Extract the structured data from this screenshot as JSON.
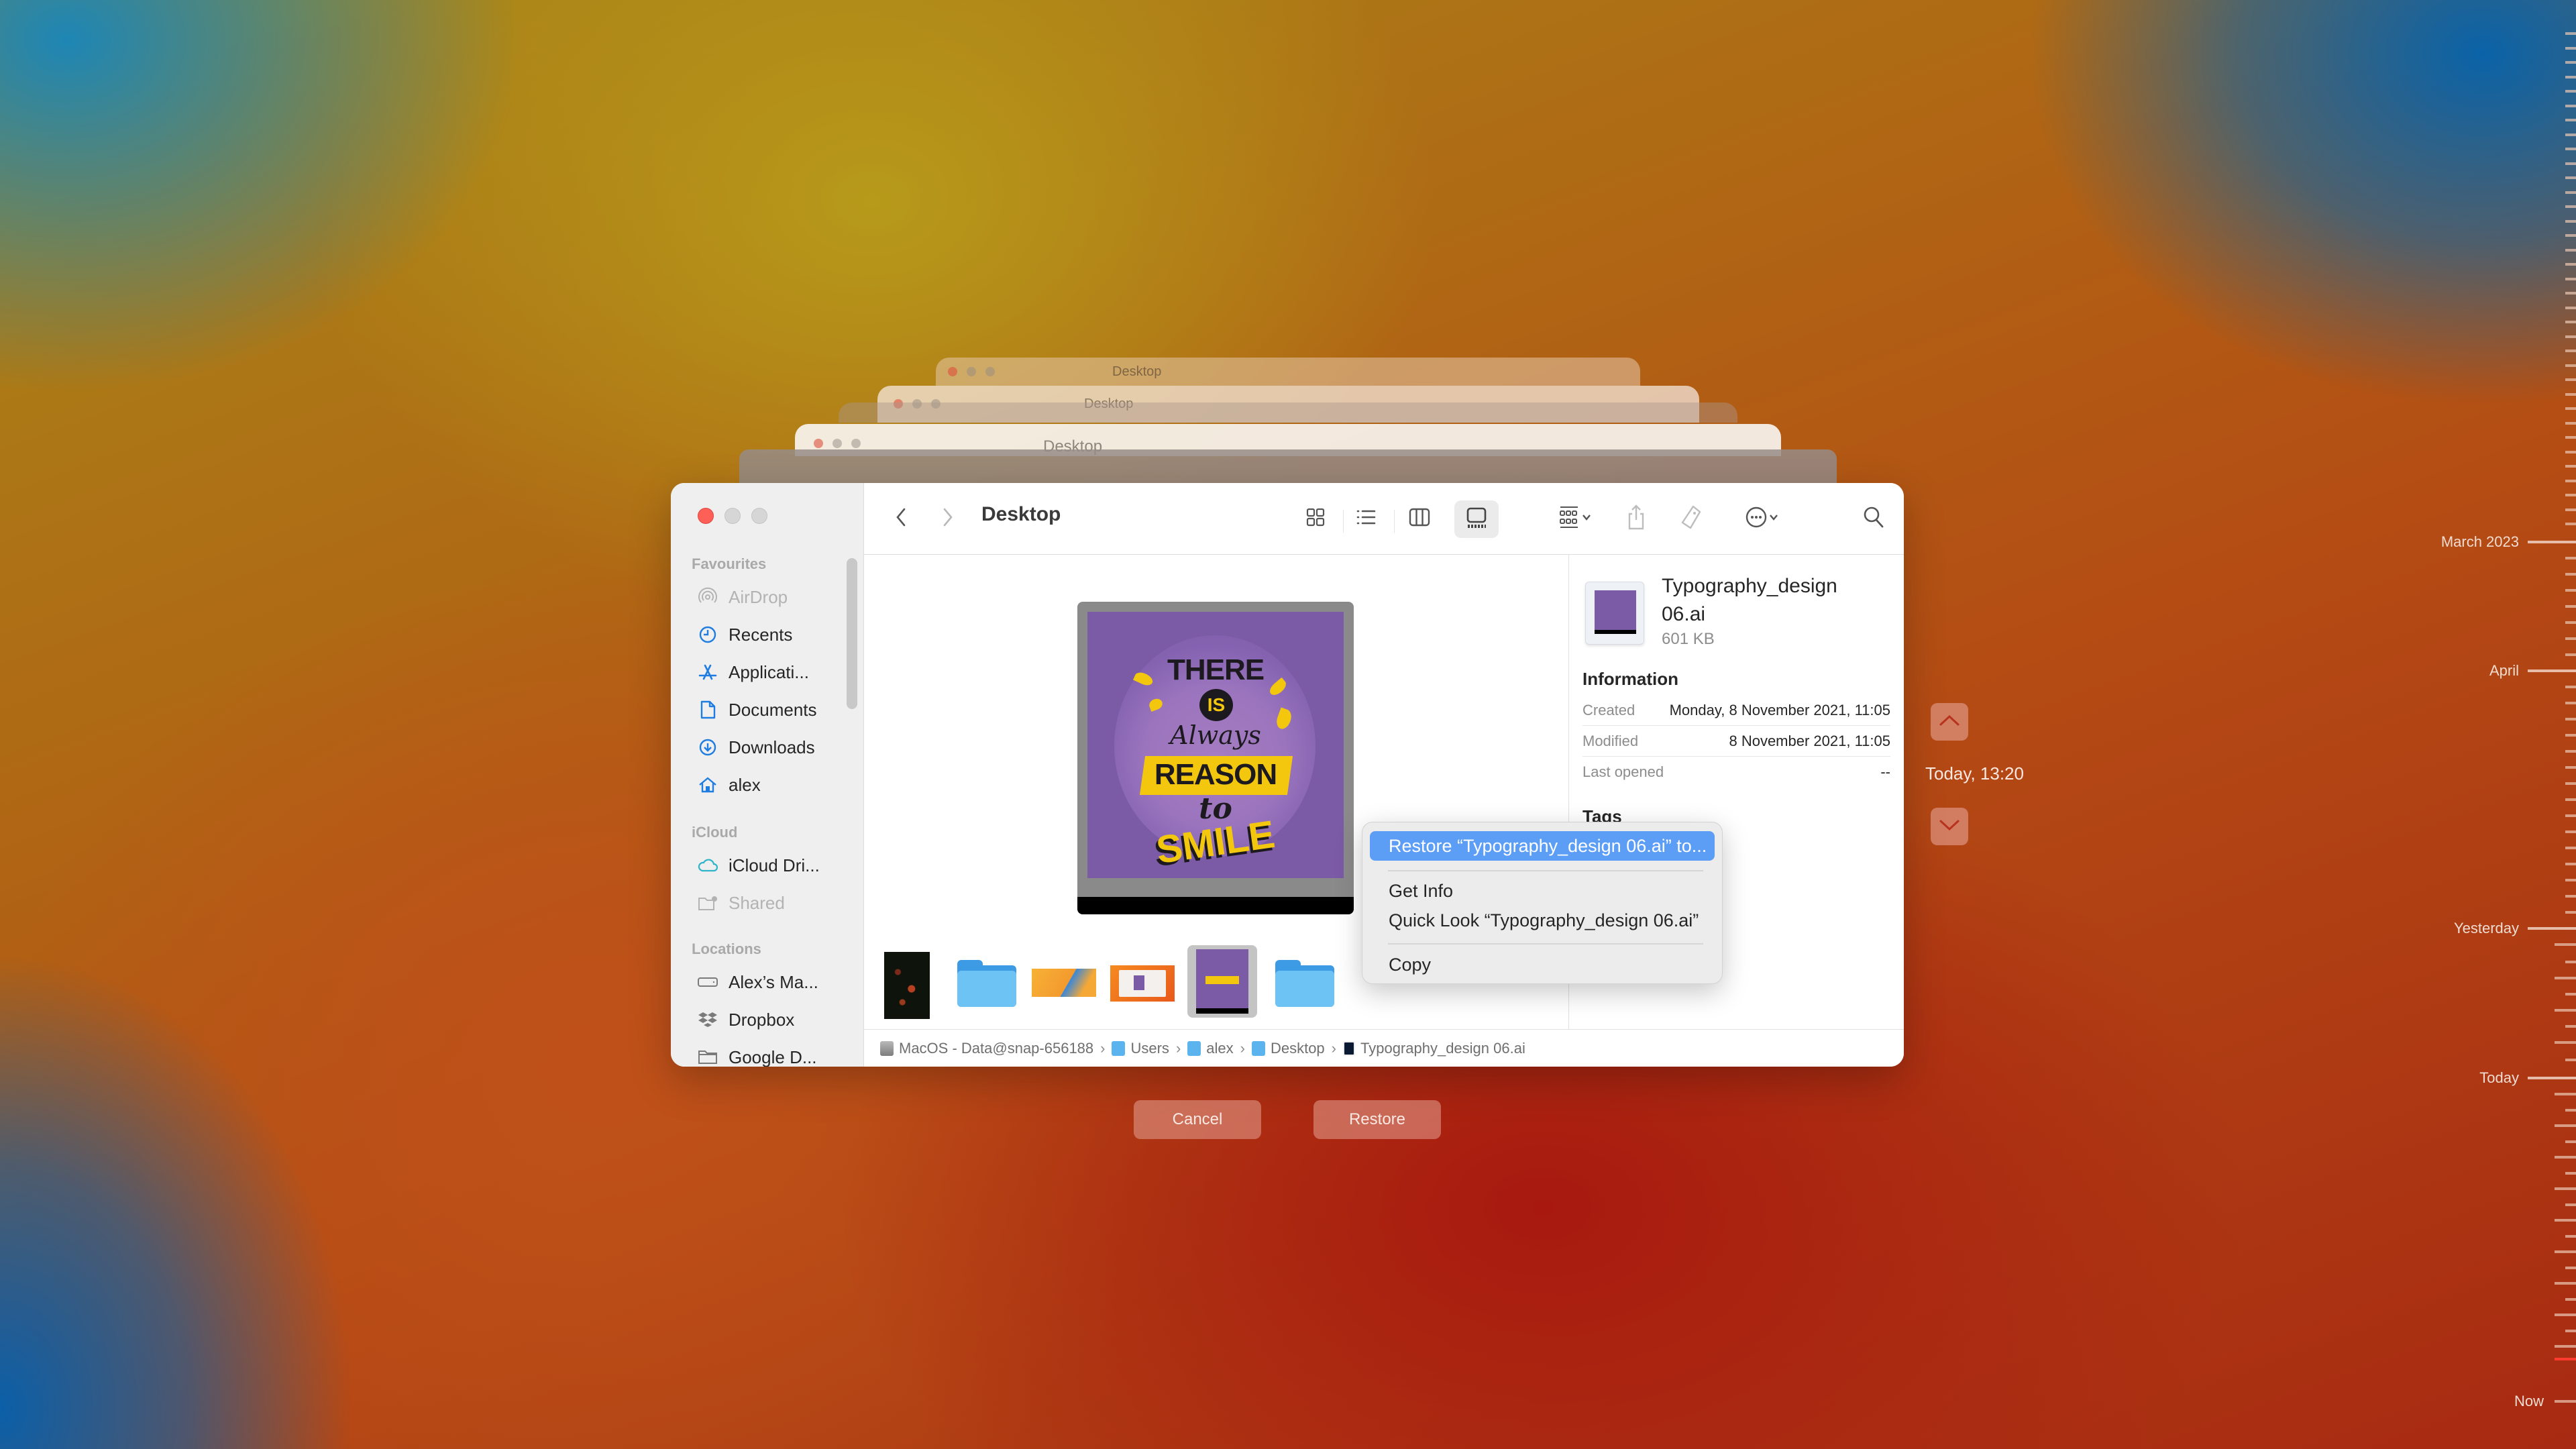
{
  "window": {
    "title": "Desktop",
    "background_windows": [
      {
        "title": "Desktop"
      },
      {
        "title": "Desktop"
      },
      {
        "title": "Desktop"
      }
    ]
  },
  "toolbar": {
    "back_icon": "chevron-left",
    "forward_icon": "chevron-right",
    "title": "Desktop",
    "views": [
      {
        "name": "icon-view",
        "active": false
      },
      {
        "name": "list-view",
        "active": false
      },
      {
        "name": "column-view",
        "active": false
      },
      {
        "name": "gallery-view",
        "active": true
      }
    ],
    "group_by_icon": "group-grid",
    "share_icon": "share",
    "tag_icon": "tag",
    "more_icon": "ellipsis-circle",
    "search_icon": "magnifying-glass"
  },
  "sidebar": {
    "sections": [
      {
        "title": "Favourites",
        "items": [
          {
            "label": "AirDrop",
            "icon": "airdrop",
            "dimmed": true
          },
          {
            "label": "Recents",
            "icon": "clock"
          },
          {
            "label": "Applicati...",
            "icon": "apps"
          },
          {
            "label": "Documents",
            "icon": "document"
          },
          {
            "label": "Downloads",
            "icon": "download"
          },
          {
            "label": "alex",
            "icon": "home"
          }
        ]
      },
      {
        "title": "iCloud",
        "items": [
          {
            "label": "iCloud Dri...",
            "icon": "cloud"
          },
          {
            "label": "Shared",
            "icon": "shared-folder",
            "dimmed": true
          }
        ]
      },
      {
        "title": "Locations",
        "items": [
          {
            "label": "Alex’s Ma...",
            "icon": "drive"
          },
          {
            "label": "Dropbox",
            "icon": "dropbox"
          },
          {
            "label": "Google D...",
            "icon": "folder"
          }
        ]
      }
    ]
  },
  "gallery": {
    "preview": {
      "lines": [
        "THERE",
        "IS",
        "Always",
        "REASON",
        "to",
        "SMILE"
      ]
    },
    "thumbnails": [
      {
        "type": "photo",
        "name": "dark-floral-photo"
      },
      {
        "type": "folder",
        "name": "folder"
      },
      {
        "type": "image",
        "name": "screenshot-orange"
      },
      {
        "type": "image",
        "name": "screenshot-finder"
      },
      {
        "type": "image",
        "name": "Typography_design 06.ai",
        "selected": true
      },
      {
        "type": "folder",
        "name": "folder"
      }
    ]
  },
  "inspector": {
    "file_name_line1": "Typography_design",
    "file_name_line2": "06.ai",
    "file_size": "601 KB",
    "information_heading": "Information",
    "rows": [
      {
        "key": "Created",
        "value": "Monday, 8 November 2021, 11:05"
      },
      {
        "key": "Modified",
        "value": "8 November 2021, 11:05"
      },
      {
        "key": "Last opened",
        "value": "--"
      }
    ],
    "tags_heading": "Tags"
  },
  "context_menu": {
    "items": [
      {
        "label": "Restore “Typography_design 06.ai” to...",
        "highlighted": true
      },
      {
        "label": "Get Info"
      },
      {
        "label": "Quick Look “Typography_design 06.ai”"
      },
      {
        "label": "Copy"
      }
    ]
  },
  "path_bar": [
    {
      "label": "MacOS - Data@snap-656188",
      "icon": "disk"
    },
    {
      "label": "Users",
      "icon": "folder"
    },
    {
      "label": "alex",
      "icon": "home-folder"
    },
    {
      "label": "Desktop",
      "icon": "desktop-folder"
    },
    {
      "label": "Typography_design 06.ai",
      "icon": "ai-file"
    }
  ],
  "time_machine": {
    "cancel_label": "Cancel",
    "restore_label": "Restore",
    "current_snapshot": "Today, 13:20",
    "timeline_labels": [
      "March 2023",
      "April",
      "Yesterday",
      "Today",
      "Now"
    ],
    "accent_color": "#ff3b30"
  }
}
